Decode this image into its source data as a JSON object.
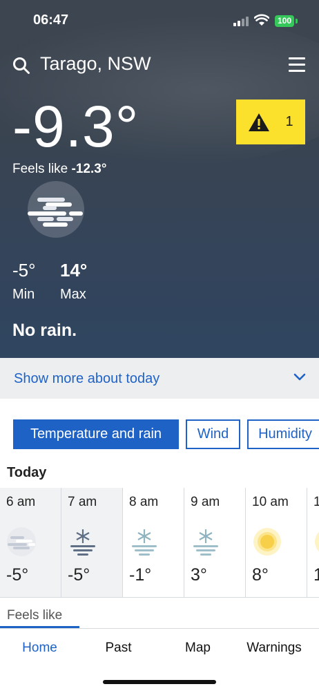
{
  "status_bar": {
    "time": "06:47",
    "battery": "100"
  },
  "header": {
    "location": "Tarago, NSW"
  },
  "current": {
    "temperature": "-9.3°",
    "feels_like_label": "Feels like",
    "feels_like_value": "-12.3°",
    "icon": "fog-icon",
    "warning_count": "1",
    "min_value": "-5°",
    "min_label": "Min",
    "max_value": "14°",
    "max_label": "Max",
    "rain": "No rain."
  },
  "show_more": {
    "label": "Show more about today"
  },
  "tabs": [
    {
      "label": "Temperature and rain",
      "active": true
    },
    {
      "label": "Wind",
      "active": false
    },
    {
      "label": "Humidity",
      "active": false
    }
  ],
  "hourly": {
    "heading": "Today",
    "hours": [
      {
        "time": "6 am",
        "temp": "-5°",
        "icon": "fog-icon"
      },
      {
        "time": "7 am",
        "temp": "-5°",
        "icon": "frost-icon"
      },
      {
        "time": "8 am",
        "temp": "-1°",
        "icon": "frost-icon"
      },
      {
        "time": "9 am",
        "temp": "3°",
        "icon": "frost-icon"
      },
      {
        "time": "10 am",
        "temp": "8°",
        "icon": "sunny-icon"
      },
      {
        "time": "1",
        "temp": "1",
        "icon": "sunny-icon"
      }
    ],
    "feels_like_label": "Feels like"
  },
  "bottom_nav": [
    {
      "label": "Home",
      "active": true
    },
    {
      "label": "Past",
      "active": false
    },
    {
      "label": "Map",
      "active": false
    },
    {
      "label": "Warnings",
      "active": false
    }
  ],
  "colors": {
    "accent": "#1f62c6",
    "warning": "#fbe02c",
    "battery": "#35c759"
  }
}
